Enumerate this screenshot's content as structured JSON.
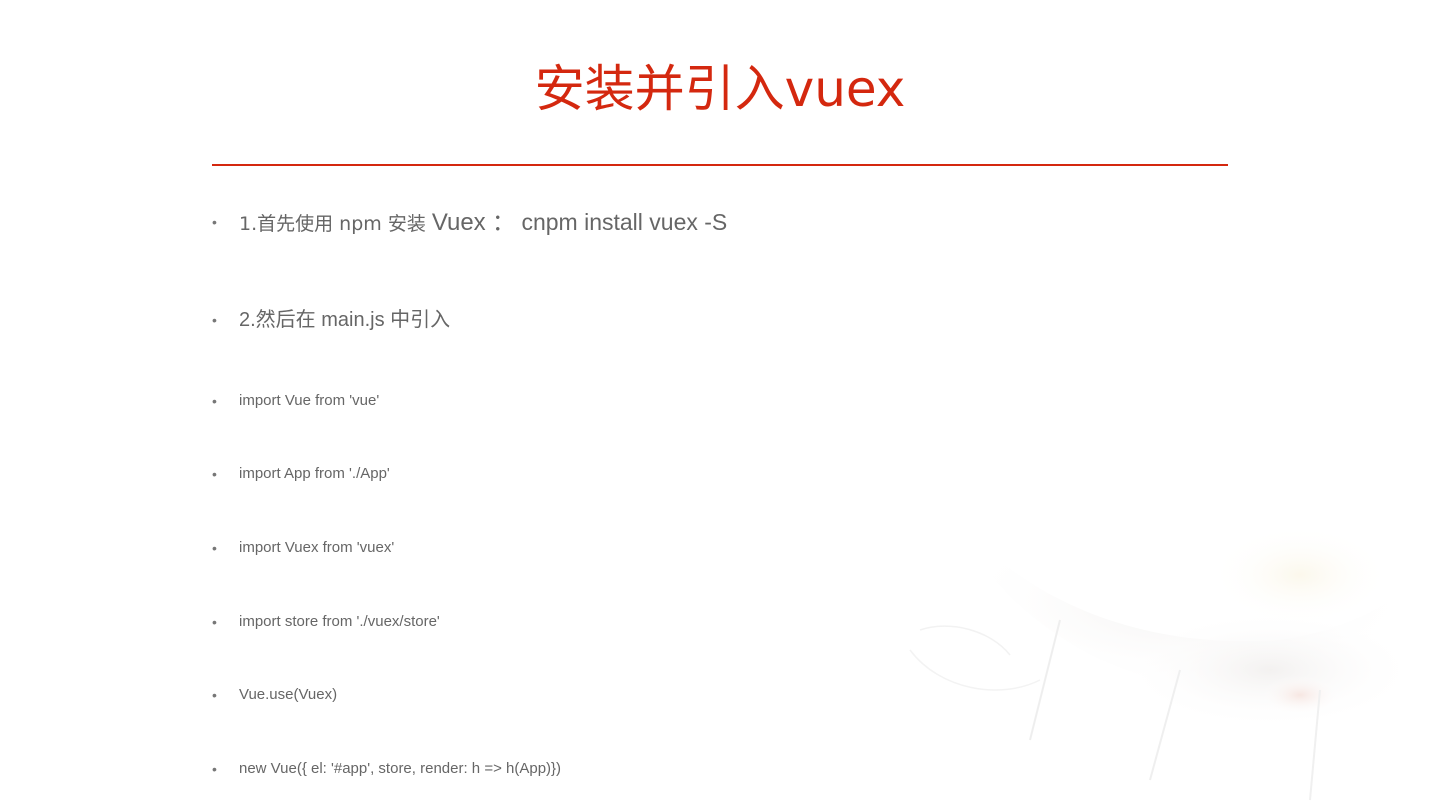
{
  "slide": {
    "title": "安装并引入vuex",
    "accent_color": "#d4280f",
    "bullet_glyph": "•",
    "steps": [
      {
        "parts": [
          "1.首先使用 npm 安装 ",
          "Vuex",
          " ：",
          " cnpm install vuex -S"
        ]
      },
      {
        "text": "2.然后在 main.js 中引入"
      }
    ],
    "code_lines": [
      "import Vue from 'vue'",
      "import App from './App'",
      "import Vuex from 'vuex'",
      "import store from './vuex/store'",
      "Vue.use(Vuex)",
      "new Vue({  el: '#app',  store,  render: h => h(App)})"
    ]
  }
}
